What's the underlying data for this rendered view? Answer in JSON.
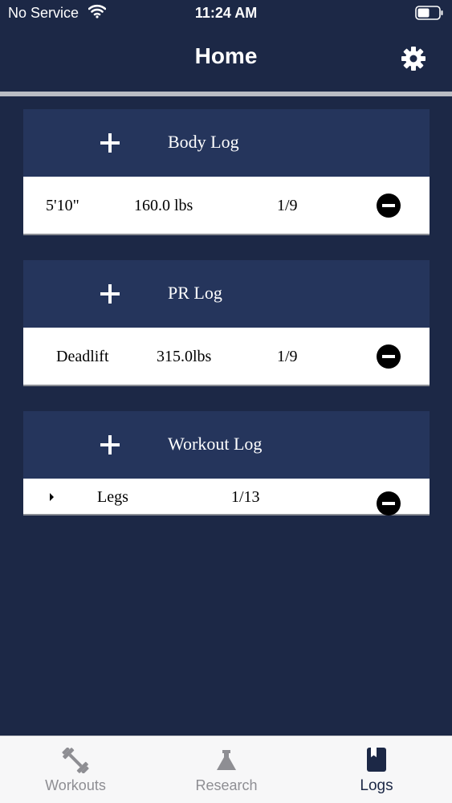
{
  "status_bar": {
    "carrier": "No Service",
    "time": "11:24 AM"
  },
  "header": {
    "title": "Home"
  },
  "body_log": {
    "title": "Body Log",
    "entry": {
      "height": "5'10\"",
      "weight": "160.0 lbs",
      "date": "1/9"
    }
  },
  "pr_log": {
    "title": "PR Log",
    "entry": {
      "exercise": "Deadlift",
      "weight": "315.0lbs",
      "date": "1/9"
    }
  },
  "workout_log": {
    "title": "Workout Log",
    "entry": {
      "name": "Legs",
      "date": "1/13"
    }
  },
  "tab_bar": {
    "tabs": [
      {
        "label": "Workouts",
        "icon": "dumbbell-icon",
        "active": false
      },
      {
        "label": "Research",
        "icon": "flask-icon",
        "active": false
      },
      {
        "label": "Logs",
        "icon": "book-icon",
        "active": true
      }
    ]
  },
  "colors": {
    "background": "#1c2846",
    "card_header": "#25355c",
    "active_tab": "#1c2846",
    "inactive_tab": "#8e8e93"
  }
}
